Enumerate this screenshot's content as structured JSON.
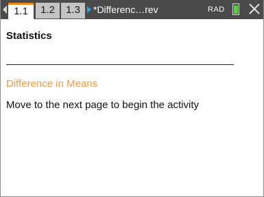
{
  "header": {
    "tabs": [
      {
        "label": "1.1"
      },
      {
        "label": "1.2"
      },
      {
        "label": "1.3"
      }
    ],
    "document_title": "*Differenc…rev",
    "angle_mode": "RAD",
    "battery_level": 0.8,
    "colors": {
      "bar": "#4a4a4a",
      "active_tab_accent": "#e8891c",
      "doc_marker": "#29a6e6",
      "battery": "#57d23a"
    },
    "icons": [
      "chevron-left-icon",
      "play-marker-icon",
      "battery-icon",
      "close-icon"
    ]
  },
  "page": {
    "heading": "Statistics",
    "subtitle": "Difference in Means",
    "subtitle_color": "#f19a45",
    "instruction": "Move to the next page to begin the activity"
  }
}
